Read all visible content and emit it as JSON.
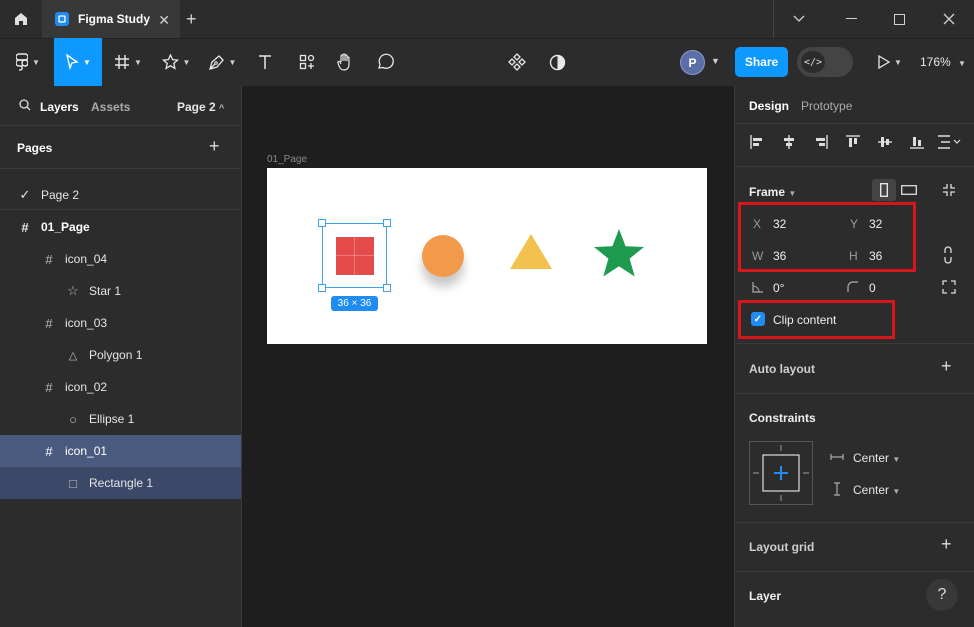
{
  "tab": {
    "title": "Figma Study"
  },
  "toolbar": {
    "share_label": "Share",
    "zoom": "176%",
    "avatar_initial": "P",
    "devmode_label": "</>"
  },
  "left_panel": {
    "tabs": [
      "Layers",
      "Assets"
    ],
    "page_selector": "Page 2",
    "pages_header": "Pages",
    "current_page": "Page 2",
    "layers": [
      {
        "name": "01_Page",
        "icon": "frame-icon",
        "depth": 0
      },
      {
        "name": "icon_04",
        "icon": "frame-icon",
        "depth": 1
      },
      {
        "name": "Star 1",
        "icon": "star-icon",
        "depth": 2
      },
      {
        "name": "icon_03",
        "icon": "frame-icon",
        "depth": 1
      },
      {
        "name": "Polygon 1",
        "icon": "triangle-icon",
        "depth": 2
      },
      {
        "name": "icon_02",
        "icon": "frame-icon",
        "depth": 1
      },
      {
        "name": "Ellipse 1",
        "icon": "circle-icon",
        "depth": 2
      },
      {
        "name": "icon_01",
        "icon": "frame-icon",
        "depth": 1
      },
      {
        "name": "Rectangle 1",
        "icon": "square-icon",
        "depth": 2
      }
    ]
  },
  "canvas": {
    "frame_label": "01_Page",
    "size_badge": "36 × 36",
    "colors": {
      "rect": "#e64b4b",
      "ellipse": "#f3994a",
      "triangle": "#f2c14e",
      "star": "#1e9a4e",
      "selection": "#3da2e8"
    }
  },
  "right_panel": {
    "tabs": [
      "Design",
      "Prototype"
    ],
    "frame_header": "Frame",
    "x_label": "X",
    "x_value": "32",
    "y_label": "Y",
    "y_value": "32",
    "w_label": "W",
    "w_value": "36",
    "h_label": "H",
    "h_value": "36",
    "rotation_value": "0°",
    "radius_value": "0",
    "clip_content_label": "Clip content",
    "auto_layout_label": "Auto layout",
    "constraints_label": "Constraints",
    "constraint_h": "Center",
    "constraint_v": "Center",
    "layout_grid_label": "Layout grid",
    "layer_label": "Layer",
    "help_label": "?"
  }
}
